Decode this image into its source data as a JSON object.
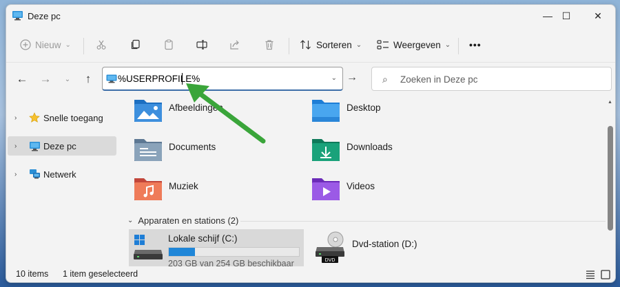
{
  "window": {
    "title": "Deze pc",
    "controls": {
      "minimize": "—",
      "maximize": "☐",
      "close": "✕"
    }
  },
  "toolbar": {
    "new_label": "Nieuw",
    "sort_label": "Sorteren",
    "view_label": "Weergeven",
    "more_label": "•••"
  },
  "address": {
    "path": "%USERPROFILE%",
    "search_placeholder": "Zoeken in Deze pc"
  },
  "sidebar": {
    "items": [
      {
        "label": "Snelle toegang"
      },
      {
        "label": "Deze pc"
      },
      {
        "label": "Netwerk"
      }
    ]
  },
  "folders": [
    {
      "name": "Afbeeldingen",
      "icon": "pictures-folder-icon"
    },
    {
      "name": "Desktop",
      "icon": "desktop-folder-icon"
    },
    {
      "name": "Documents",
      "icon": "documents-folder-icon"
    },
    {
      "name": "Downloads",
      "icon": "downloads-folder-icon"
    },
    {
      "name": "Muziek",
      "icon": "music-folder-icon"
    },
    {
      "name": "Videos",
      "icon": "videos-folder-icon"
    }
  ],
  "devices": {
    "header": "Apparaten en stations (2)",
    "drives": [
      {
        "name": "Lokale schijf (C:)",
        "detail": "203 GB van 254 GB beschikbaar",
        "used_fraction": 0.2
      },
      {
        "name": "Dvd-station (D:)",
        "badge": "DVD"
      }
    ]
  },
  "status": {
    "item_count": "10 items",
    "selection": "1 item geselecteerd"
  },
  "colors": {
    "accent": "#3c6ea8",
    "drive_bar": "#1f86d8",
    "annotation_arrow": "#3aa53a"
  }
}
